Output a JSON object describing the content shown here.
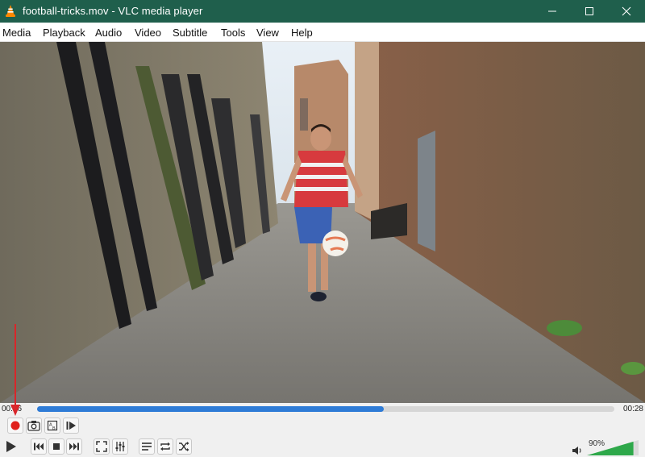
{
  "window": {
    "title": "football-tricks.mov - VLC media player"
  },
  "menu": {
    "items": [
      "Media",
      "Playback",
      "Audio",
      "Video",
      "Subtitle",
      "Tools",
      "View",
      "Help"
    ]
  },
  "playback": {
    "elapsed": "00:16",
    "total": "00:28",
    "progress": 0.6
  },
  "volume": {
    "label": "90%",
    "level": 0.9
  },
  "icons": {
    "record": "record-icon",
    "snapshot": "camera-icon",
    "loop_ab": "ab-loop-icon",
    "frame_step": "frame-step-icon",
    "play": "play-icon",
    "previous": "skip-previous-icon",
    "stop": "stop-icon",
    "next": "skip-next-icon",
    "fullscreen": "fullscreen-icon",
    "extended": "equalizer-icon",
    "playlist": "playlist-icon",
    "loop": "loop-icon",
    "shuffle": "shuffle-icon",
    "speaker": "speaker-icon"
  },
  "colors": {
    "titlebar": "#1f5f4c",
    "seek_fill": "#2e7bd6",
    "record": "#e0201b",
    "volume_fill": "#2ea84a",
    "annotation": "#d9262a"
  }
}
